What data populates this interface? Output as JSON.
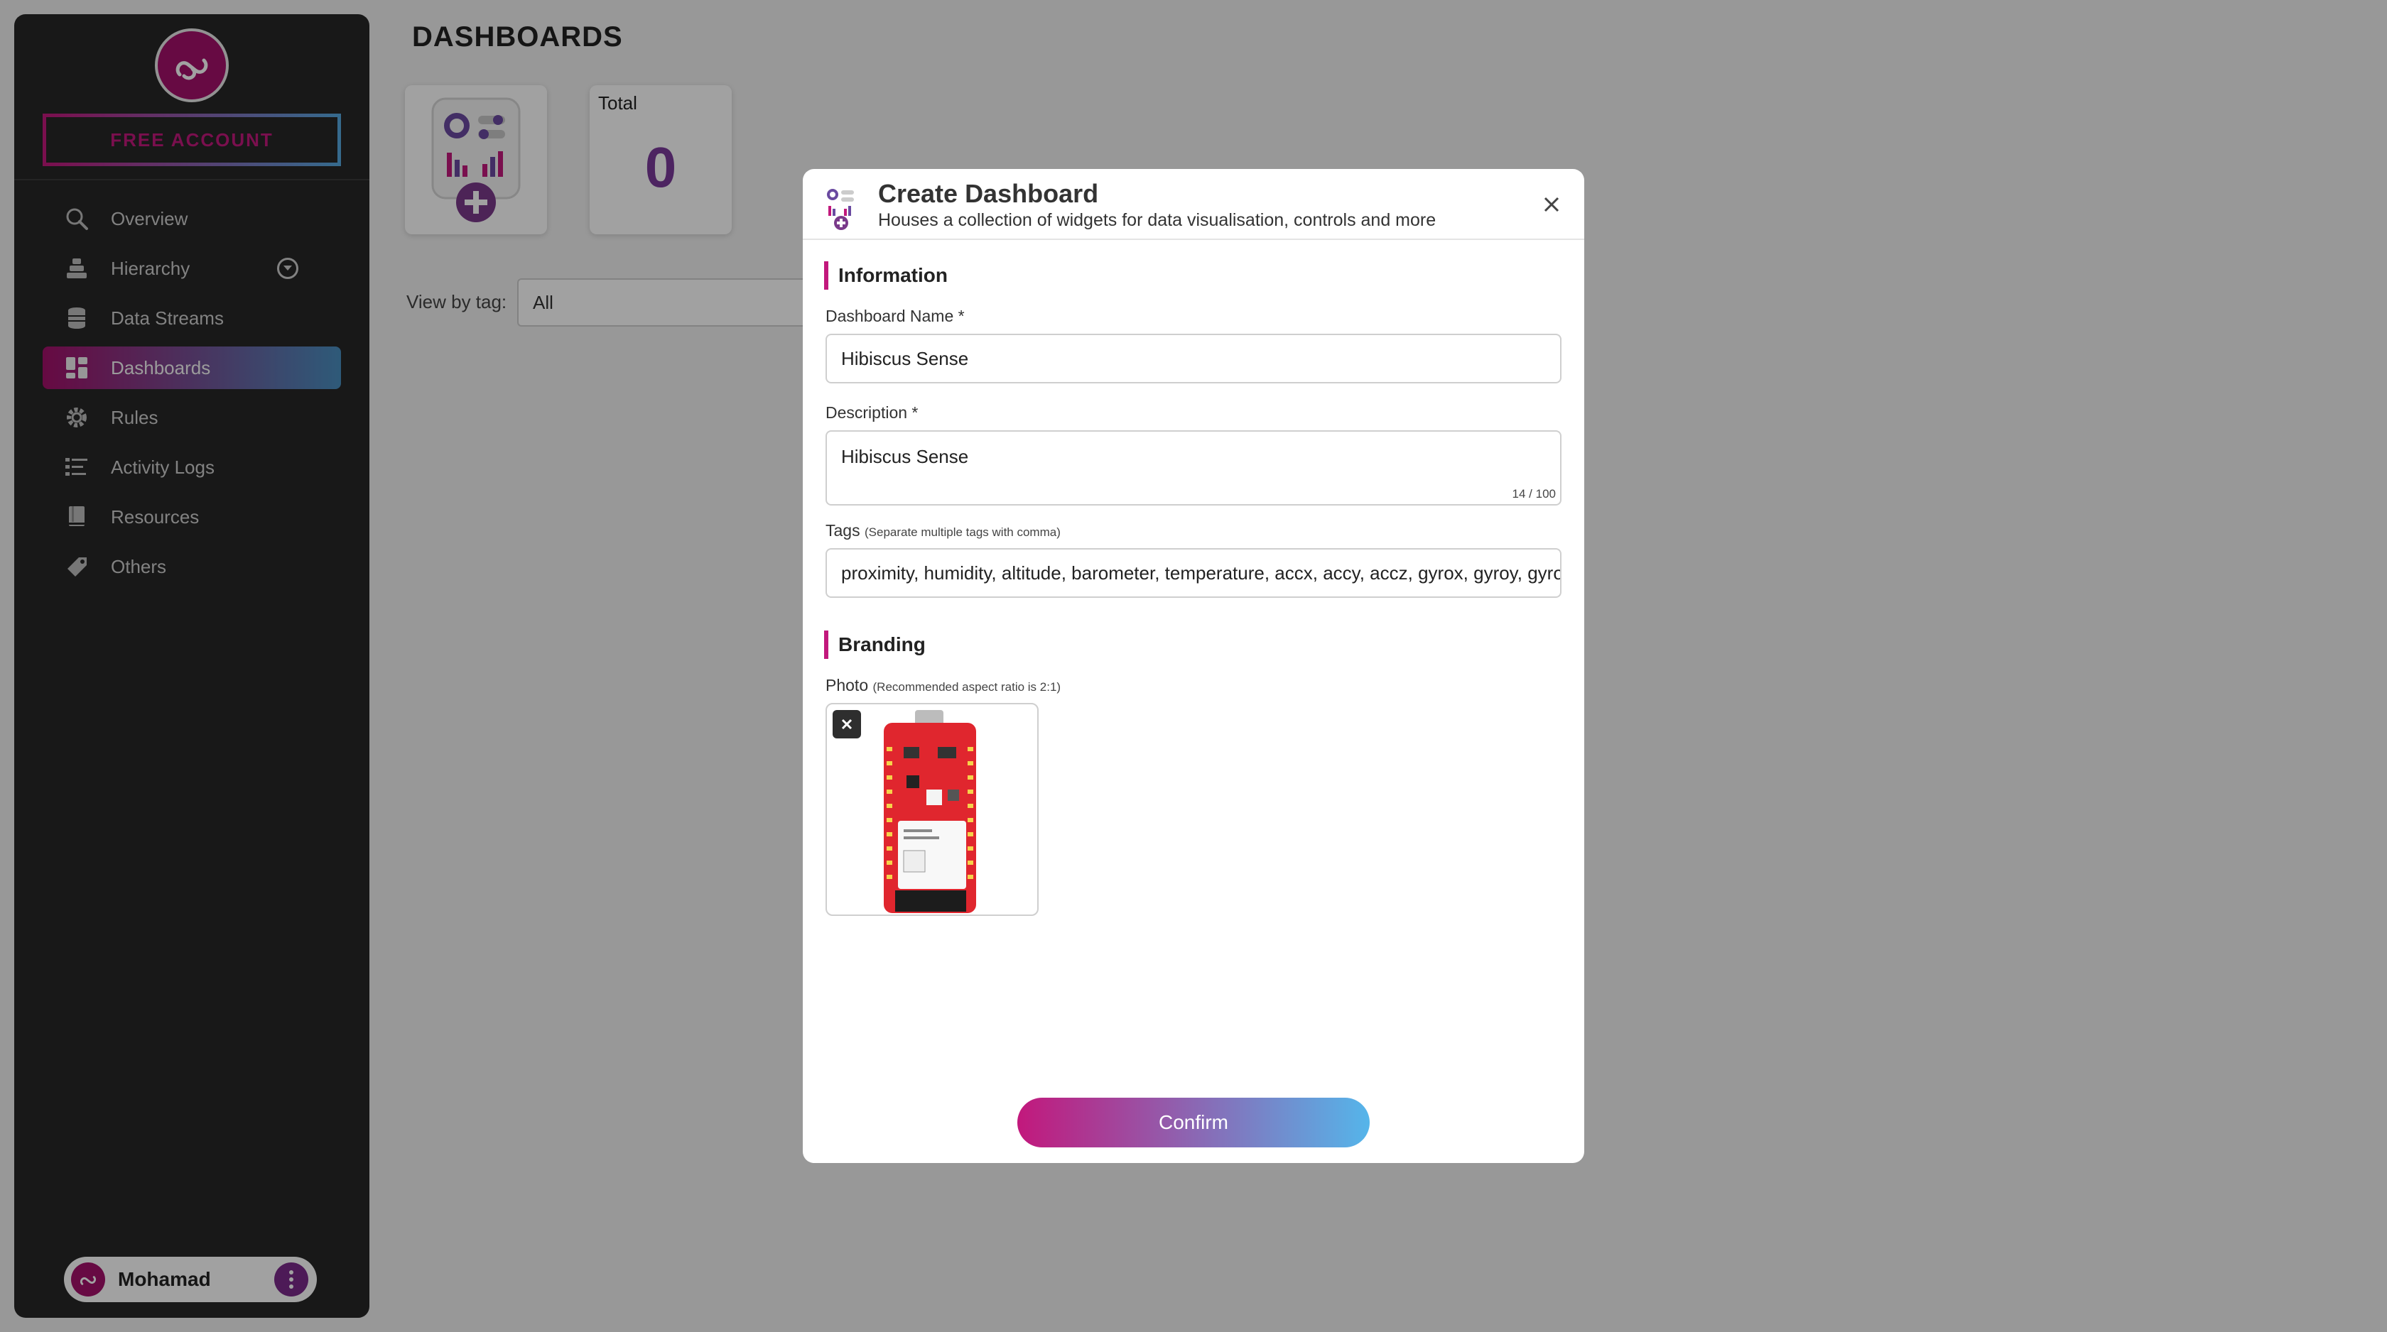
{
  "sidebar": {
    "account_button": "FREE ACCOUNT",
    "items": [
      {
        "label": "Overview",
        "icon": "search-icon"
      },
      {
        "label": "Hierarchy",
        "icon": "hierarchy-icon"
      },
      {
        "label": "Data Streams",
        "icon": "database-icon"
      },
      {
        "label": "Dashboards",
        "icon": "dashboard-icon",
        "active": true
      },
      {
        "label": "Rules",
        "icon": "gear-icon"
      },
      {
        "label": "Activity Logs",
        "icon": "list-icon"
      },
      {
        "label": "Resources",
        "icon": "book-icon"
      },
      {
        "label": "Others",
        "icon": "tag-icon"
      }
    ],
    "user": {
      "name": "Mohamad"
    }
  },
  "main": {
    "title": "DASHBOARDS",
    "total_card": {
      "label": "Total",
      "value": "0"
    },
    "view_by_tag": {
      "label": "View by tag:",
      "value": "All"
    }
  },
  "modal": {
    "title": "Create Dashboard",
    "subtitle": "Houses a collection of widgets for data visualisation, controls and more",
    "information_heading": "Information",
    "name_label": "Dashboard Name *",
    "name_value": "Hibiscus Sense",
    "description_label": "Description *",
    "description_value": "Hibiscus Sense",
    "description_counter": "14 / 100",
    "tags_label": "Tags",
    "tags_hint": "(Separate multiple tags with comma)",
    "tags_value": "proximity, humidity, altitude, barometer, temperature, accx, accy, accz, gyrox, gyroy, gyroz",
    "branding_heading": "Branding",
    "photo_label": "Photo",
    "photo_hint": "(Recommended aspect ratio is 2:1)",
    "confirm_label": "Confirm"
  },
  "colors": {
    "brand_magenta": "#c2187c",
    "brand_blue": "#55b5ea",
    "sidebar_bg": "#262626"
  }
}
